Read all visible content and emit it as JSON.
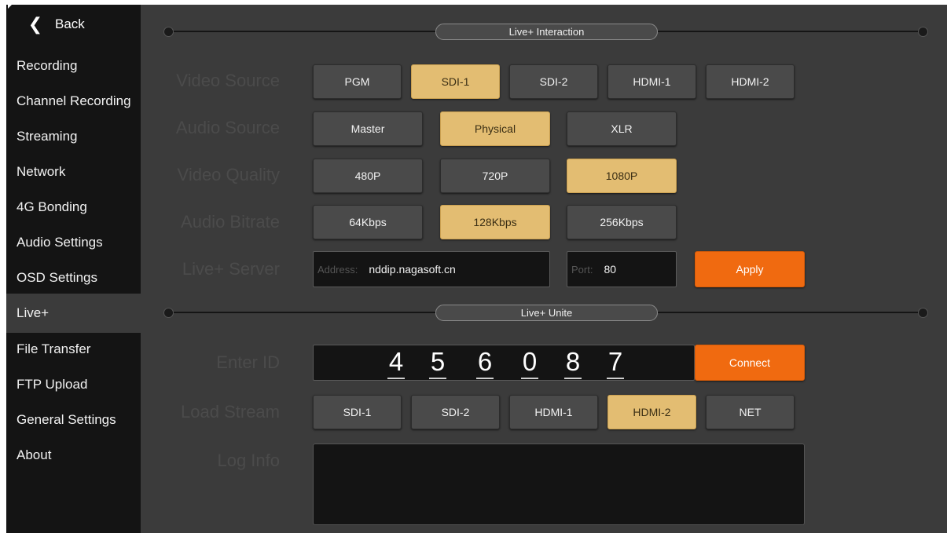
{
  "sidebar": {
    "back_label": "Back",
    "items": [
      {
        "label": "Recording",
        "active": false
      },
      {
        "label": "Channel Recording",
        "active": false
      },
      {
        "label": "Streaming",
        "active": false
      },
      {
        "label": "Network",
        "active": false
      },
      {
        "label": "4G Bonding",
        "active": false
      },
      {
        "label": "Audio Settings",
        "active": false
      },
      {
        "label": "OSD Settings",
        "active": false
      },
      {
        "label": "Live+",
        "active": true
      },
      {
        "label": "File Transfer",
        "active": false
      },
      {
        "label": "FTP Upload",
        "active": false
      },
      {
        "label": "General Settings",
        "active": false
      },
      {
        "label": "About",
        "active": false
      }
    ]
  },
  "live_interaction": {
    "title": "Live+ Interaction",
    "video_source": {
      "label": "Video Source",
      "options": [
        "PGM",
        "SDI-1",
        "SDI-2",
        "HDMI-1",
        "HDMI-2"
      ],
      "selected": "SDI-1"
    },
    "audio_source": {
      "label": "Audio Source",
      "options": [
        "Master",
        "Physical",
        "XLR"
      ],
      "selected": "Physical"
    },
    "video_quality": {
      "label": "Video Quality",
      "options": [
        "480P",
        "720P",
        "1080P"
      ],
      "selected": "1080P"
    },
    "audio_bitrate": {
      "label": "Audio Bitrate",
      "options": [
        "64Kbps",
        "128Kbps",
        "256Kbps"
      ],
      "selected": "128Kbps"
    },
    "server": {
      "label": "Live+ Server",
      "address_placeholder": "Address:",
      "address_value": "nddip.nagasoft.cn",
      "port_placeholder": "Port:",
      "port_value": "80",
      "apply_label": "Apply"
    }
  },
  "live_unite": {
    "title": "Live+ Unite",
    "enter_id": {
      "label": "Enter ID",
      "digits": [
        "4",
        "5",
        "6",
        "0",
        "8",
        "7"
      ],
      "connect_label": "Connect"
    },
    "load_stream": {
      "label": "Load Stream",
      "options": [
        "SDI-1",
        "SDI-2",
        "HDMI-1",
        "HDMI-2",
        "NET"
      ],
      "selected": "HDMI-2"
    },
    "log_info": {
      "label": "Log Info"
    }
  },
  "colors": {
    "selected": "#e3bd72",
    "action": "#f06a10",
    "sidebar_bg": "#141414",
    "panel_bg": "#3b3b3b"
  }
}
